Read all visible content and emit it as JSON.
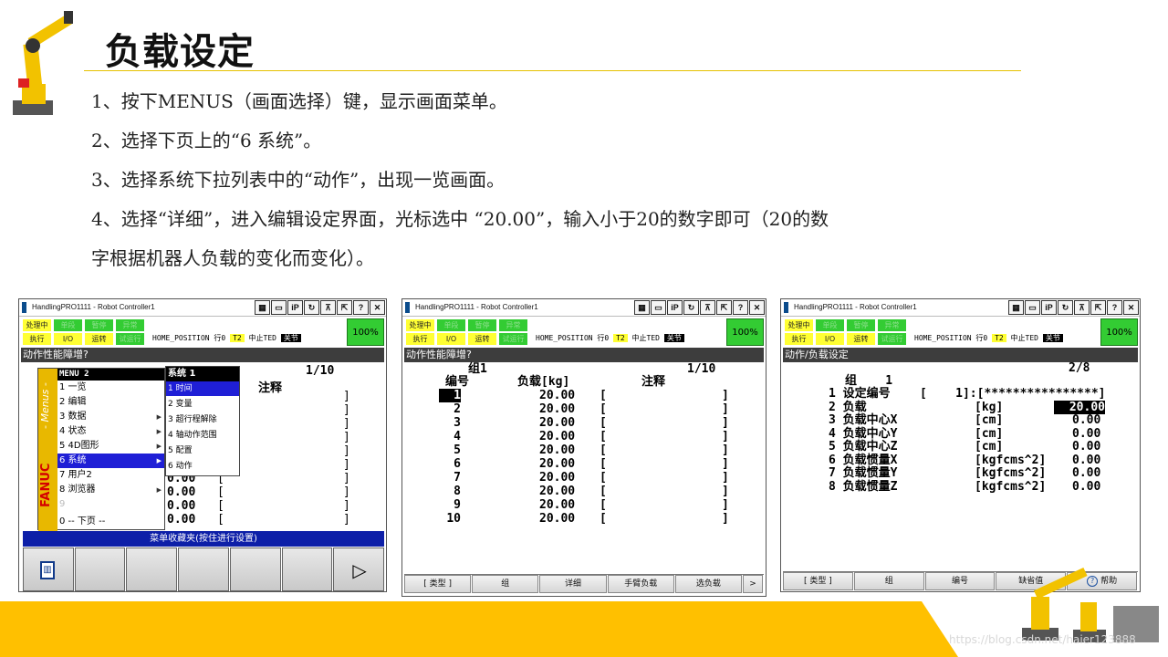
{
  "slide": {
    "title": "负载设定",
    "steps": [
      "1、按下MENUS（画面选择）键，显示画面菜单。",
      "2、选择下页上的“6 系统”。",
      "3、选择系统下拉列表中的“动作”，出现一览画面。",
      "4、选择“详细”，进入编辑设定界面，光标选中 “20.00”，输入小于20的数字即可（20的数",
      "字根据机器人负载的变化而变化）。"
    ],
    "watermark": "https://blog.csdn.net/haier123888"
  },
  "window": {
    "title": "HandlingPRO1111 - Robot Controller1",
    "buttons": [
      "▦",
      "▭",
      "iP",
      "↻",
      "⊼",
      "⇱",
      "?",
      "✕"
    ]
  },
  "status": {
    "leds_top": [
      "处理中",
      "单段",
      "暂停",
      "异常"
    ],
    "leds_bottom": [
      "执行",
      "I/O",
      "运转",
      "试运行"
    ],
    "position_text": "HOME_POSITION 行0",
    "mode": "T2",
    "state": "中止TED",
    "joint": "关节",
    "percent": "100%"
  },
  "screen1": {
    "header": "动作性能障增?",
    "page": "1/10",
    "note_col": "注释",
    "visible_values": [
      "0.00",
      "0.00",
      "0.00",
      "0.00"
    ],
    "menu_title": "MENU  2",
    "band_text": "- Menus -",
    "band_brand": "FANUC",
    "menu_items": [
      {
        "label": "1 一览",
        "sub": false
      },
      {
        "label": "2 编辑",
        "sub": false
      },
      {
        "label": "3 数据",
        "sub": true
      },
      {
        "label": "4 状态",
        "sub": true
      },
      {
        "label": "5 4D图形",
        "sub": true
      },
      {
        "label": "6 系统",
        "sub": true
      },
      {
        "label": "7 用户2",
        "sub": false
      },
      {
        "label": "8 浏览器",
        "sub": true
      },
      {
        "label": "9",
        "sub": false
      },
      {
        "label": "0 -- 下页 --",
        "sub": false
      }
    ],
    "submenu_title": "系统  1",
    "submenu_items": [
      "1 时间",
      "2 变量",
      "3 超行程解除",
      "4 轴动作范围",
      "5 配置",
      "6 动作"
    ],
    "favorites_bar": "菜单收藏夹(按住进行设置)"
  },
  "screen2": {
    "header": "动作性能障增?",
    "group": "组1",
    "page": "1/10",
    "col_no": "编号",
    "col_load": "负载[kg]",
    "col_note": "注释",
    "rows": [
      {
        "no": "1",
        "load": "20.00"
      },
      {
        "no": "2",
        "load": "20.00"
      },
      {
        "no": "3",
        "load": "20.00"
      },
      {
        "no": "4",
        "load": "20.00"
      },
      {
        "no": "5",
        "load": "20.00"
      },
      {
        "no": "6",
        "load": "20.00"
      },
      {
        "no": "7",
        "load": "20.00"
      },
      {
        "no": "8",
        "load": "20.00"
      },
      {
        "no": "9",
        "load": "20.00"
      },
      {
        "no": "10",
        "load": "20.00"
      }
    ],
    "fkeys": [
      "[ 类型 ]",
      "组",
      "详细",
      "手臂负载",
      "选负载",
      ">"
    ]
  },
  "screen3": {
    "header": "动作/负载设定",
    "page": "2/8",
    "group": "组    1",
    "rows": [
      {
        "no": "1",
        "label": "设定编号",
        "unit": "[    1]:[****************]",
        "value": ""
      },
      {
        "no": "2",
        "label": "负载",
        "unit": "[kg]",
        "value": "20.00"
      },
      {
        "no": "3",
        "label": "负载中心X",
        "unit": "[cm]",
        "value": "0.00"
      },
      {
        "no": "4",
        "label": "负载中心Y",
        "unit": "[cm]",
        "value": "0.00"
      },
      {
        "no": "5",
        "label": "负载中心Z",
        "unit": "[cm]",
        "value": "0.00"
      },
      {
        "no": "6",
        "label": "负载惯量X",
        "unit": "[kgfcms^2]",
        "value": "0.00"
      },
      {
        "no": "7",
        "label": "负载惯量Y",
        "unit": "[kgfcms^2]",
        "value": "0.00"
      },
      {
        "no": "8",
        "label": "负载惯量Z",
        "unit": "[kgfcms^2]",
        "value": "0.00"
      }
    ],
    "fkeys": [
      "[ 类型 ]",
      "组",
      "编号",
      "缺省值",
      "帮助"
    ]
  },
  "colors": {
    "accent": "#e6c100",
    "footer": "#ffc000",
    "menu_select": "#1f1fd6",
    "led_on": "#ffff33",
    "led_ok": "#33cc33"
  }
}
